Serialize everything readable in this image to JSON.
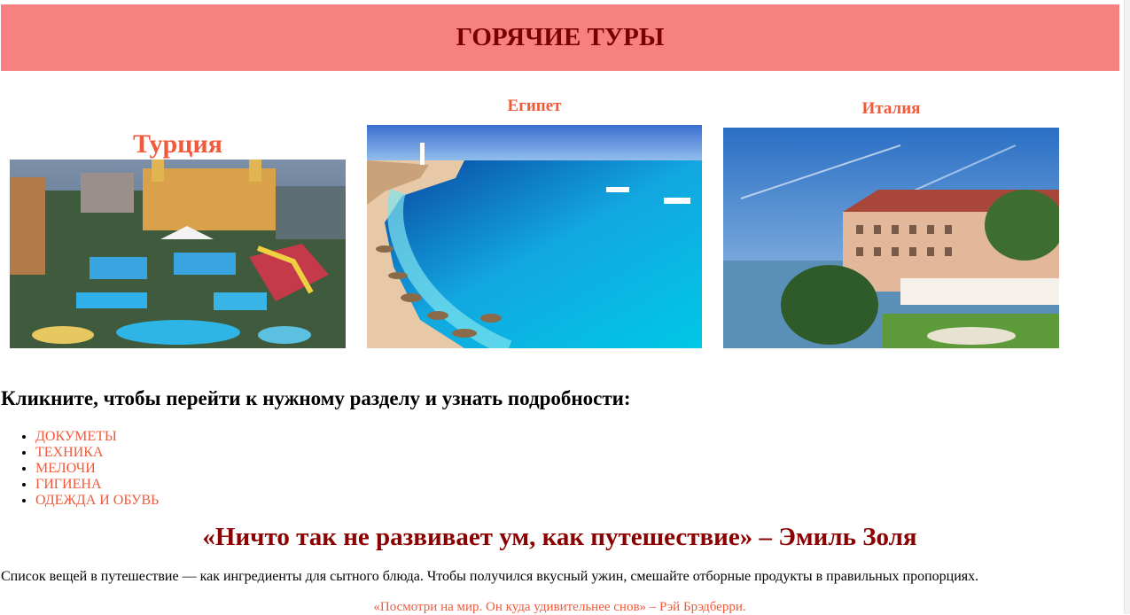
{
  "header": {
    "title": "ГОРЯЧИЕ ТУРЫ"
  },
  "tours": [
    {
      "title": "Турция",
      "image": "turkey-resort-photo"
    },
    {
      "title": "Египет",
      "image": "egypt-beach-photo"
    },
    {
      "title": "Италия",
      "image": "italy-hotel-photo"
    }
  ],
  "sections": {
    "prompt": "Кликните, чтобы перейти к нужному разделу и узнать подробности:",
    "links": [
      "ДОКУМЕТЫ",
      "ТЕХНИКА",
      "МЕЛОЧИ",
      "ГИГИЕНА",
      "ОДЕЖДА И ОБУВЬ"
    ]
  },
  "quote": "«Ничто так не развивает ум, как путешествие» – Эмиль Золя",
  "paragraph": "Список вещей в путешествие — как ингредиенты для сытного блюда. Чтобы получился вкусный ужин, смешайте отборные продукты в правильных пропорциях.",
  "footer_quote": "«Посмотри на мир. Он куда удивительнее снов» – Рэй Брэдберри.",
  "colors": {
    "banner_bg": "#f78181",
    "banner_text": "#7a0000",
    "accent": "#f15a3a",
    "quote": "#8b0000"
  }
}
